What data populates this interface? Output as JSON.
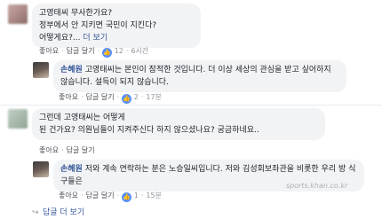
{
  "comments": [
    {
      "text": "고영태씨 무사한가요?\n정부에서 안 지키면 국민이 지킨다?\n어떻게요?... ",
      "more": "더 보기",
      "like": "좋아요",
      "reply": "답글 달기",
      "reactions": "12",
      "time": "6시간"
    },
    {
      "author": "손혜원",
      "text": " 고영태씨는 본인이 잠적한 것입니다. 더 이상 세상의 관심을 받고 싶어하지 않습니다. 설득이 되지 않습니다.",
      "like": "좋아요",
      "reply": "답글 달기",
      "reactions": "2",
      "time": "17분"
    },
    {
      "text": "그런데 고영태씨는 어떻게\n된 건가요? 의원님들이 지켜주신다 하지 않으셨나요? 궁금하네요..",
      "like": "좋아요",
      "reply": "답글 달기"
    },
    {
      "author": "손혜원",
      "text": " 저와 계속 연락하는 분은 노승일씨입니다. 저와 김성회보좌관을 비롯한 우리 방 식구들은 ",
      "like": "좋아요",
      "reply": "답글 달기",
      "reactions": "1",
      "time": "15분"
    }
  ],
  "more_replies": "답글 더 보기",
  "reply_arrow_icon": "reply-arrow-icon",
  "watermark": "sports.khan.co.kr"
}
